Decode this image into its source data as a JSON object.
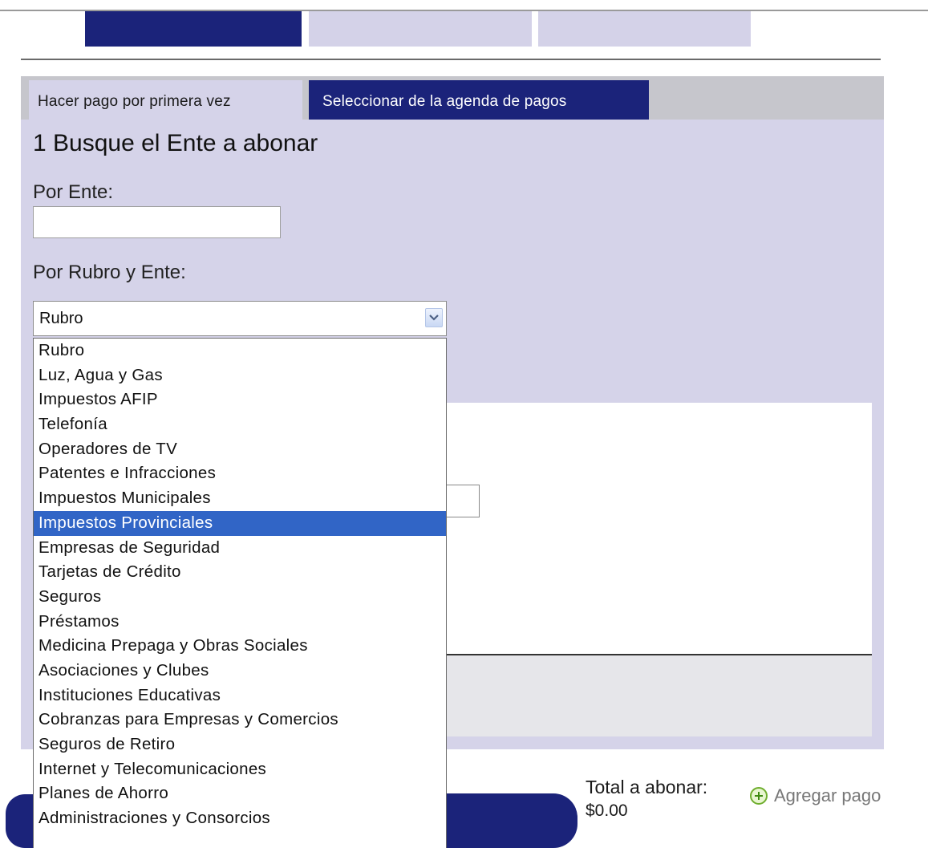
{
  "tabs": {
    "first_time": "Hacer pago por primera vez",
    "agenda": "Seleccionar de la agenda de pagos"
  },
  "section": {
    "title": "1 Busque el Ente a abonar",
    "by_entity_label": "Por Ente:",
    "by_category_label": "Por Rubro y Ente:",
    "by_entity_value": ""
  },
  "rubro_select": {
    "selected_value": "Rubro",
    "options": [
      "Rubro",
      "Luz, Agua y Gas",
      "Impuestos AFIP",
      "Telefonía",
      "Operadores de TV",
      "Patentes e Infracciones",
      "Impuestos Municipales",
      "Impuestos Provinciales",
      "Empresas de Seguridad",
      "Tarjetas de Crédito",
      "Seguros",
      "Préstamos",
      "Medicina Prepaga y Obras Sociales",
      "Asociaciones y Clubes",
      "Instituciones Educativas",
      "Cobranzas para Empresas y Comercios",
      "Seguros de Retiro",
      "Internet y Telecomunicaciones",
      "Planes de Ahorro",
      "Administraciones y Consorcios"
    ],
    "highlighted_option": "Impuestos Provinciales"
  },
  "footer": {
    "total_label": "Total a abonar:",
    "total_value": "$0.00",
    "add_payment": "Agregar pago",
    "add_payment_icon": "plus-circle-icon"
  },
  "colors": {
    "navy": "#1b237a",
    "panel": "#d5d3e9",
    "highlight": "#3165c6"
  }
}
